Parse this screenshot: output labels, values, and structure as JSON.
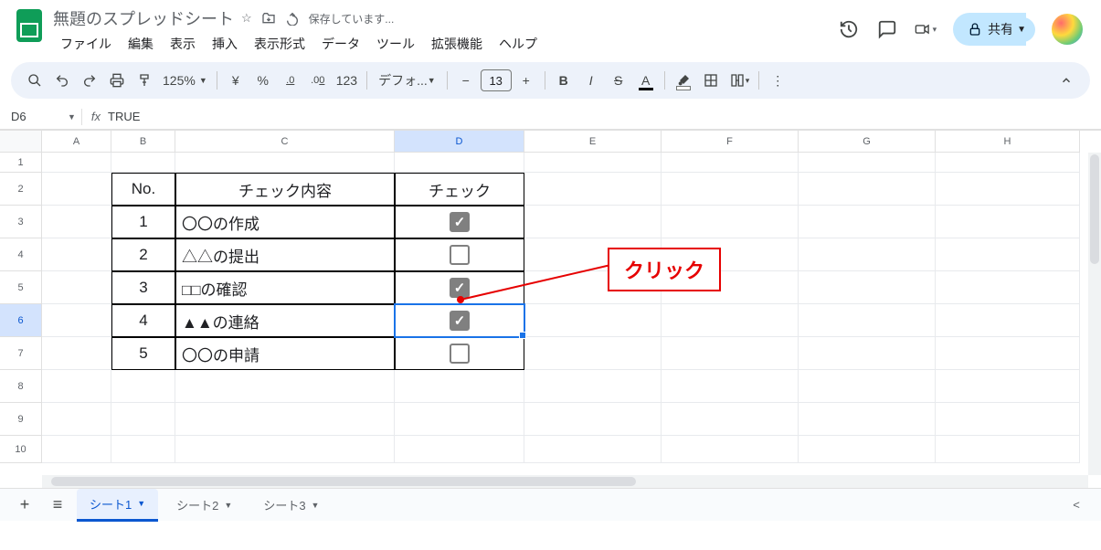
{
  "header": {
    "title": "無題のスプレッドシート",
    "saving": "保存しています...",
    "share_label": "共有"
  },
  "menus": [
    "ファイル",
    "編集",
    "表示",
    "挿入",
    "表示形式",
    "データ",
    "ツール",
    "拡張機能",
    "ヘルプ"
  ],
  "toolbar": {
    "zoom": "125%",
    "currency": "¥",
    "percent": "%",
    "dec_dec": ".0",
    "inc_dec": ".00",
    "num_fmt": "123",
    "font": "デフォ...",
    "font_size": "13",
    "bold": "B",
    "italic": "I",
    "strike": "S",
    "text_color": "A"
  },
  "namebox": "D6",
  "formula": {
    "fx": "fx",
    "value": "TRUE"
  },
  "columns": [
    {
      "label": "A",
      "w": "cA",
      "sel": false
    },
    {
      "label": "B",
      "w": "cB",
      "sel": false
    },
    {
      "label": "C",
      "w": "cC",
      "sel": false
    },
    {
      "label": "D",
      "w": "cD",
      "sel": true
    },
    {
      "label": "E",
      "w": "cE",
      "sel": false
    },
    {
      "label": "F",
      "w": "cF",
      "sel": false
    },
    {
      "label": "G",
      "w": "cG",
      "sel": false
    },
    {
      "label": "H",
      "w": "cH",
      "sel": false
    }
  ],
  "row_labels": [
    "1",
    "2",
    "3",
    "4",
    "5",
    "6",
    "7",
    "8",
    "9",
    "10"
  ],
  "selected_row": "6",
  "table": {
    "headers": {
      "no": "No.",
      "content": "チェック内容",
      "check": "チェック"
    },
    "rows": [
      {
        "no": "1",
        "content": "〇〇の作成",
        "checked": true
      },
      {
        "no": "2",
        "content": "△△の提出",
        "checked": false
      },
      {
        "no": "3",
        "content": "□□の確認",
        "checked": true
      },
      {
        "no": "4",
        "content": "▲▲の連絡",
        "checked": true
      },
      {
        "no": "5",
        "content": "〇〇の申請",
        "checked": false
      }
    ]
  },
  "annotation": {
    "label": "クリック"
  },
  "sheets": [
    {
      "name": "シート1",
      "active": true
    },
    {
      "name": "シート2",
      "active": false
    },
    {
      "name": "シート3",
      "active": false
    }
  ]
}
